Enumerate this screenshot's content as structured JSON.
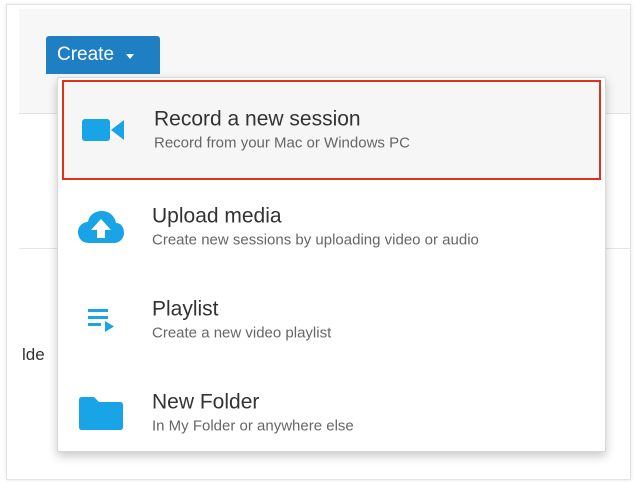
{
  "accent_color": "#1f7fc3",
  "icon_color": "#1aa4e8",
  "highlight_color": "#e0311f",
  "toolbar": {
    "create_label": "Create",
    "create_caret_icon": "caret-down-icon"
  },
  "background": {
    "partial_text": "lde"
  },
  "menu": {
    "items": [
      {
        "title": "Record a new session",
        "subtitle": "Record from your Mac or Windows PC",
        "icon": "video-camera-icon",
        "highlighted": true
      },
      {
        "title": "Upload media",
        "subtitle": "Create new sessions by uploading video or audio",
        "icon": "cloud-upload-icon",
        "highlighted": false
      },
      {
        "title": "Playlist",
        "subtitle": "Create a new video playlist",
        "icon": "playlist-icon",
        "highlighted": false
      },
      {
        "title": "New Folder",
        "subtitle": "In My Folder or anywhere else",
        "icon": "folder-icon",
        "highlighted": false
      }
    ]
  }
}
